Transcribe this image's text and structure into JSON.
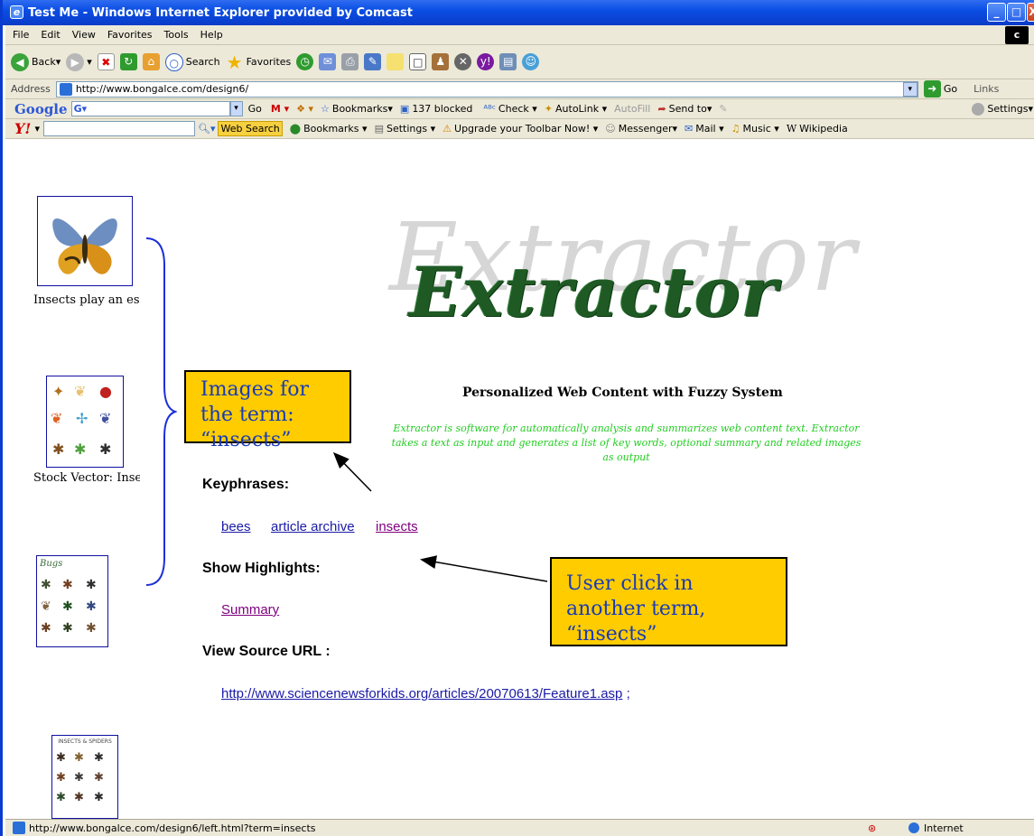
{
  "window": {
    "title": "Test Me - Windows Internet Explorer provided by Comcast"
  },
  "menu": [
    "File",
    "Edit",
    "View",
    "Favorites",
    "Tools",
    "Help"
  ],
  "toolbar": {
    "back": "Back",
    "search": "Search",
    "favorites": "Favorites"
  },
  "address": {
    "label": "Address",
    "url": "http://www.bongalce.com/design6/",
    "go": "Go",
    "links": "Links"
  },
  "google_bar": {
    "brand": "Google",
    "go": "Go",
    "bookmarks": "Bookmarks",
    "blocked": "137 blocked",
    "check": "Check",
    "autolink": "AutoLink",
    "autofill": "AutoFill",
    "sendto": "Send to",
    "settings": "Settings"
  },
  "yahoo_bar": {
    "brand": "Y!",
    "web_search": "Web Search",
    "bookmarks": "Bookmarks",
    "settings": "Settings",
    "upgrade": "Upgrade your Toolbar Now!",
    "messenger": "Messenger",
    "mail": "Mail",
    "music": "Music",
    "wikipedia": "Wikipedia"
  },
  "left": {
    "caption1": "Insects play an es:",
    "caption2": "Stock Vector: Inse",
    "thumb3_text": "Bugs",
    "thumb4_text": "INSECTS & SPIDERS"
  },
  "main": {
    "logo_back": "Extractor",
    "logo_front": "Extractor",
    "subtitle": "Personalized Web Content with Fuzzy System",
    "description": "Extractor is software for automatically analysis and summarizes web content text. Extractor takes a text as input and generates a list of key words, optional summary and related images as output",
    "keyphrases_heading": "Keyphrases:",
    "keyphrases": [
      "bees",
      "article archive",
      "insects"
    ],
    "highlights_heading": "Show Highlights:",
    "summary_link": "Summary",
    "source_heading": "View Source URL :",
    "source_url": "http://www.sciencenewsforkids.org/articles/20070613/Feature1.asp",
    "source_suffix": ";"
  },
  "callouts": {
    "images": "Images for the term: “insects”",
    "click": "User click in another term, “insects”"
  },
  "status": {
    "url": "http://www.bongalce.com/design6/left.html?term=insects",
    "zone": "Internet"
  },
  "colors": {
    "callout_bg": "#ffcc00",
    "link": "#1a1aa6",
    "visited": "#800080",
    "desc_green": "#22cc22"
  }
}
